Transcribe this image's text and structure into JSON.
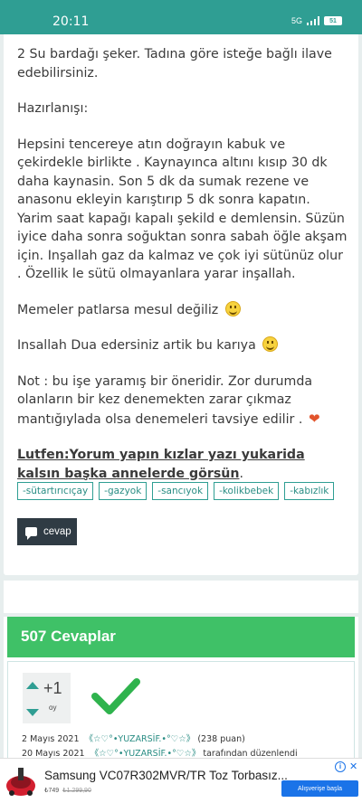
{
  "status_bar": {
    "time": "20:11",
    "battery": "51",
    "network": "5G"
  },
  "post": {
    "paragraphs": [
      "2 Su bardağı şeker.  Tadına göre isteğe bağlı ilave edebilirsiniz.",
      "Hazırlanışı:",
      "Hepsini tencereye atın doğrayın kabuk ve çekirdekle birlikte . Kaynayınca altını kısıp 30 dk daha kaynasin. Son 5 dk da sumak rezene ve anasonu ekleyin karıştırıp 5 dk sonra kapatın.  Yarim saat kapağı kapalı şekild e demlensin.  Süzün iyice daha sonra soğuktan sonra sabah öğle akşam için. Inşallah gaz da kalmaz ve çok iyi sütünüz olur . Özellik le sütü olmayanlara yarar inşallah.",
      "Memeler patlarsa mesul değiliz",
      "Insallah Dua edersiniz artik bu karıya",
      "Not : bu işe yaramış bir öneridir.  Zor durumda olanların bir kez denemekten zarar çıkmaz mantığıylada olsa denemeleri tavsiye edilir ."
    ],
    "final_bold": "Lutfen:Yorum yapın kızlar yazı yukarida kalsın başka annelerde görsün",
    "final_suffix": ".",
    "tags": [
      "-sütartırıcıçay",
      "-gazyok",
      "-sancıyok",
      "-kolikbebek",
      "-kabızlık"
    ],
    "reply_label": "cevap"
  },
  "answers": {
    "header": "507 Cevaplar",
    "first": {
      "score": "+1",
      "score_unit": "oy",
      "line1_date": "2 Mayıs 2021",
      "line1_user": "《☆♡°•YUZARSİF.•°♡☆》",
      "line1_points": "(238 puan)",
      "line2_date": "20 Mayıs 2021",
      "line2_user": "《☆♡°•YUZARSİF.•°♡☆》",
      "line2_suffix": "tarafından düzenlendi"
    }
  },
  "ad": {
    "title": "Samsung VC07R302MVR/TR Toz Torbasız...",
    "price": "₺749",
    "old_price": "₺1.299,90",
    "cta": "Alışverişe başla"
  },
  "colors": {
    "teal": "#2f9e93",
    "green_header": "#3fc167",
    "dark_button": "#2f3b44",
    "check_green": "#2fb34d"
  }
}
